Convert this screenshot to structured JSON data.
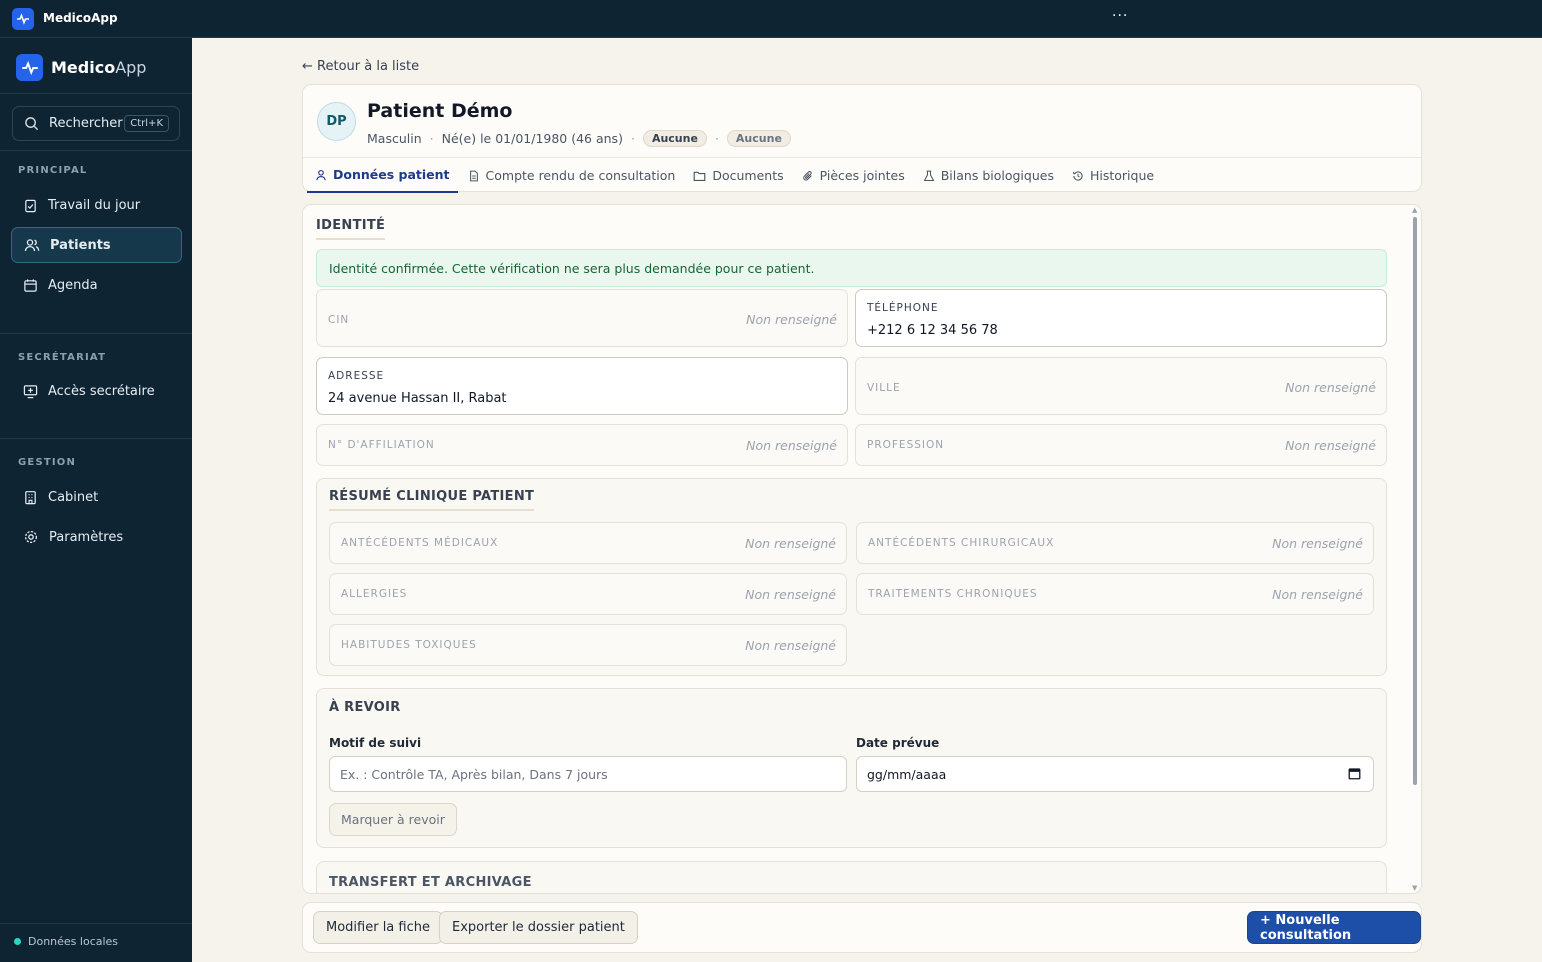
{
  "window": {
    "title": "MedicoApp",
    "menu_dots": "···"
  },
  "sidebar": {
    "brand_bold": "Medico",
    "brand_light": "App",
    "search_label": "Rechercher",
    "search_shortcut": "Ctrl+K",
    "sections": {
      "principal": "PRINCIPAL",
      "secretariat": "SECRÉTARIAT",
      "gestion": "GESTION"
    },
    "items": {
      "travail": "Travail du jour",
      "patients": "Patients",
      "agenda": "Agenda",
      "secretaire": "Accès secrétaire",
      "cabinet": "Cabinet",
      "parametres": "Paramètres"
    },
    "footer": "Données locales"
  },
  "main": {
    "back_link": "← Retour à la liste",
    "patient": {
      "initials": "DP",
      "name": "Patient Démo",
      "sex": "Masculin",
      "dob": "Né(e) le 01/01/1980 (46 ans)",
      "badge1": "Aucune",
      "badge2": "Aucune",
      "sep": "·"
    },
    "tabs": {
      "donnees": "Données patient",
      "compte_rendu": "Compte rendu de consultation",
      "documents": "Documents",
      "pieces": "Pièces jointes",
      "bilans": "Bilans biologiques",
      "historique": "Historique"
    },
    "identity": {
      "title": "IDENTITÉ",
      "alert": "Identité confirmée. Cette vérification ne sera plus demandée pour ce patient.",
      "empty": "Non renseigné",
      "cin_label": "CIN",
      "phone_label": "TÉLÉPHONE",
      "phone_value": "+212 6 12 34 56 78",
      "address_label": "ADRESSE",
      "address_value": "24 avenue Hassan II, Rabat",
      "ville_label": "VILLE",
      "affiliation_label": "N° D'AFFILIATION",
      "profession_label": "PROFESSION"
    },
    "clinical": {
      "title": "RÉSUMÉ CLINIQUE PATIENT",
      "antecedents_medicaux": "ANTÉCÉDENTS MÉDICAUX",
      "antecedents_chirurgicaux": "ANTÉCÉDENTS CHIRURGICAUX",
      "allergies": "ALLERGIES",
      "traitements": "TRAITEMENTS CHRONIQUES",
      "habitudes": "HABITUDES TOXIQUES"
    },
    "revoir": {
      "title": "À REVOIR",
      "motif_label": "Motif de suivi",
      "motif_placeholder": "Ex. : Contrôle TA, Après bilan, Dans 7 jours",
      "date_label": "Date prévue",
      "date_value": "gg/mm/aaaa",
      "mark_button": "Marquer à revoir"
    },
    "transfer": {
      "title": "TRANSFERT ET ARCHIVAGE"
    },
    "actions": {
      "modifier": "Modifier la fiche",
      "exporter": "Exporter le dossier patient",
      "nouvelle": "+ Nouvelle consultation"
    }
  },
  "colors": {
    "sidebar_bg": "#0f2433",
    "accent": "#1d4ea8",
    "success_bg": "#e9f7ee"
  }
}
